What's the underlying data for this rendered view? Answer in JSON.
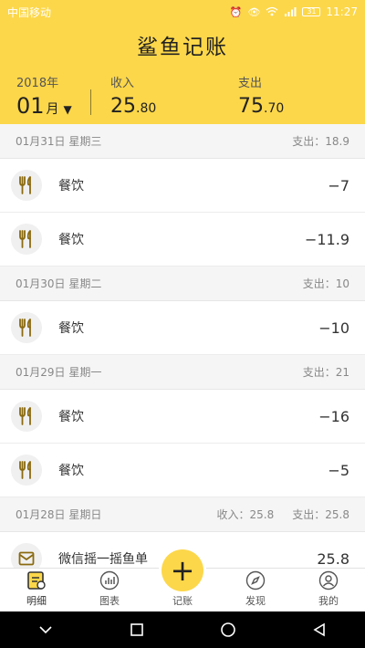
{
  "status_bar": {
    "carrier": "中国移动",
    "time": "11:27",
    "battery": "31"
  },
  "app_title": "鲨鱼记账",
  "summary": {
    "year": "2018年",
    "month": "01",
    "month_unit": "月",
    "income_label": "收入",
    "income_int": "25",
    "income_dec": ".80",
    "expense_label": "支出",
    "expense_int": "75",
    "expense_dec": ".70"
  },
  "days": [
    {
      "date": "01月31日 星期三",
      "income": "",
      "expense": "支出：18.9",
      "entries": [
        {
          "icon": "fork-knife-icon",
          "category": "餐饮",
          "amount": "−7"
        },
        {
          "icon": "fork-knife-icon",
          "category": "餐饮",
          "amount": "−11.9"
        }
      ]
    },
    {
      "date": "01月30日 星期二",
      "income": "",
      "expense": "支出：10",
      "entries": [
        {
          "icon": "fork-knife-icon",
          "category": "餐饮",
          "amount": "−10"
        }
      ]
    },
    {
      "date": "01月29日 星期一",
      "income": "",
      "expense": "支出：21",
      "entries": [
        {
          "icon": "fork-knife-icon",
          "category": "餐饮",
          "amount": "−16"
        },
        {
          "icon": "fork-knife-icon",
          "category": "餐饮",
          "amount": "−5"
        }
      ]
    },
    {
      "date": "01月28日 星期日",
      "income": "收入：25.8",
      "expense": "支出：25.8",
      "entries": [
        {
          "icon": "envelope-icon",
          "category": "微信摇一摇鱼单",
          "amount": "25.8"
        }
      ]
    }
  ],
  "tabs": [
    {
      "label": "明细",
      "icon": "detail-icon"
    },
    {
      "label": "图表",
      "icon": "chart-icon"
    },
    {
      "label": "记账",
      "icon": "plus-icon"
    },
    {
      "label": "发现",
      "icon": "compass-icon"
    },
    {
      "label": "我的",
      "icon": "user-icon"
    }
  ],
  "colors": {
    "accent": "#fcd74a"
  }
}
